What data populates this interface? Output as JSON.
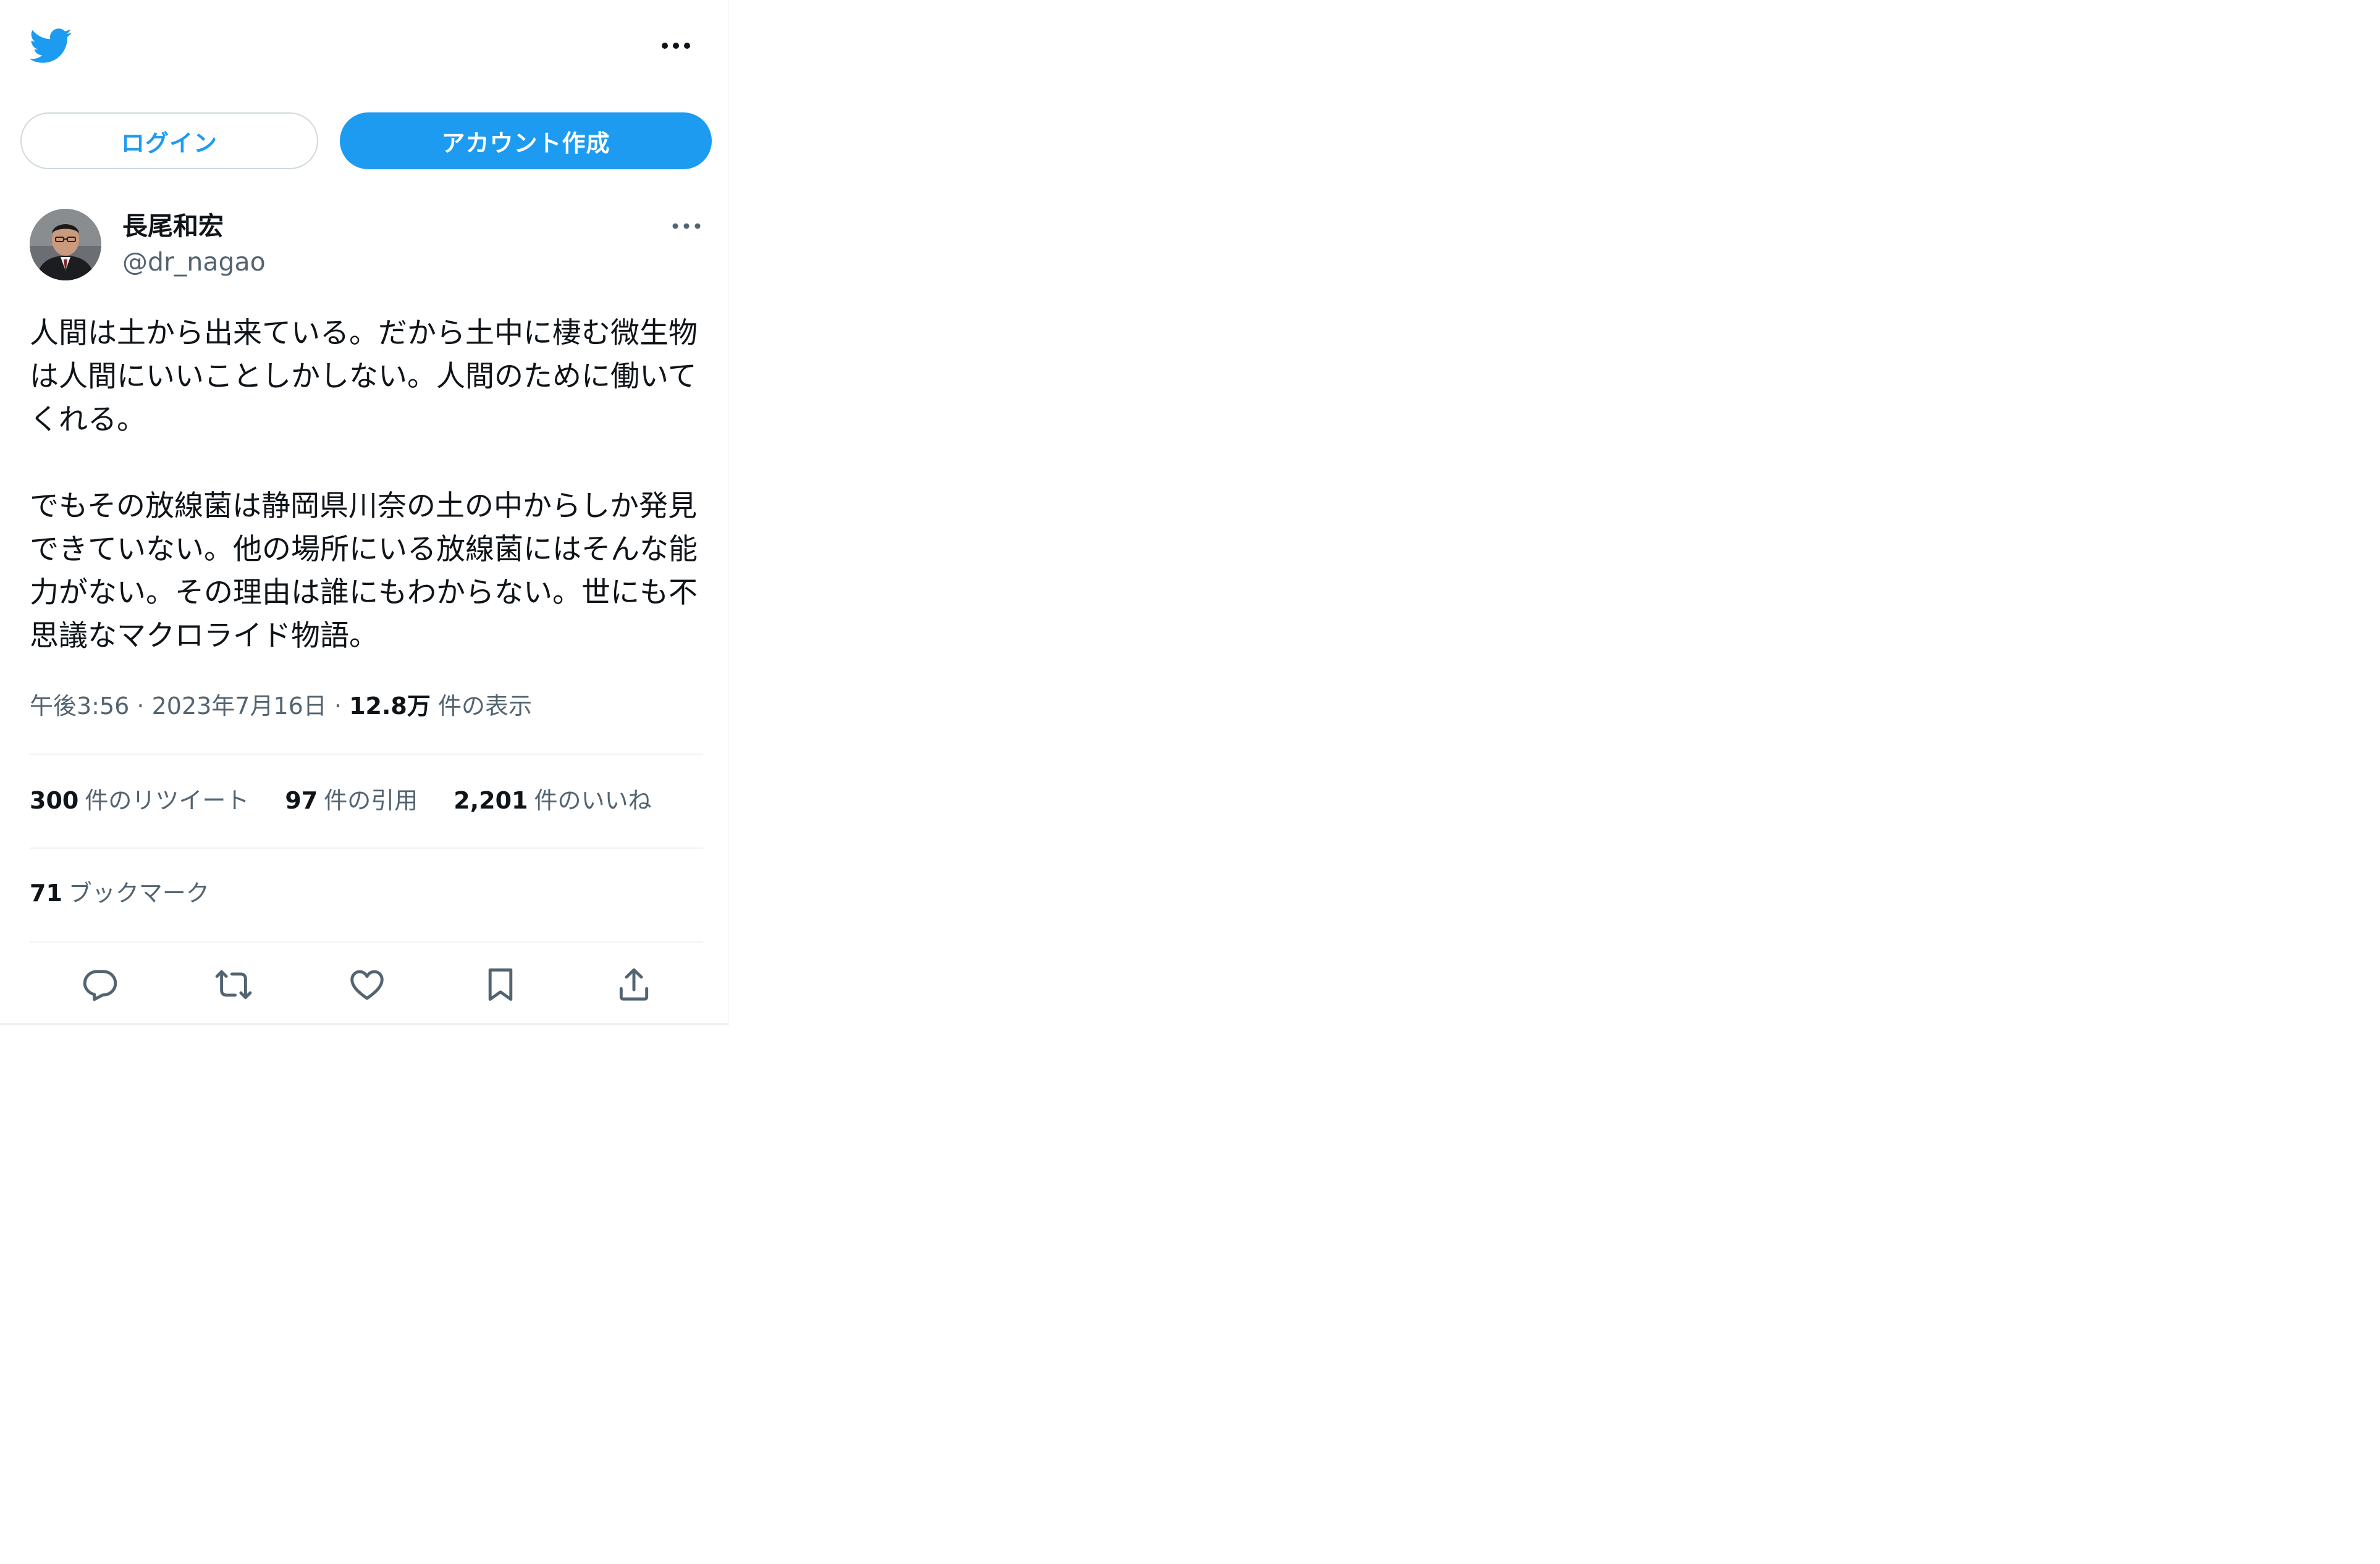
{
  "header": {
    "logo_icon": "twitter-bird-icon",
    "more_icon": "more-horizontal-icon"
  },
  "auth": {
    "login_label": "ログイン",
    "signup_label": "アカウント作成"
  },
  "tweet": {
    "author_name": "長尾和宏",
    "author_handle": "@dr_nagao",
    "body_paragraph_1": "人間は土から出来ている。だから土中に棲む微生物は人間にいいことしかしない。人間のために働いてくれる。",
    "body_paragraph_2": "でもその放線菌は静岡県川奈の土の中からしか発見できていない。他の場所にいる放線菌にはそんな能力がない。その理由は誰にもわからない。世にも不思議なマクロライド物語。",
    "time": "午後3:56",
    "separator_1": " · ",
    "date": "2023年7月16日",
    "separator_2": " · ",
    "views_count": "12.8万",
    "views_label": "件の表示"
  },
  "stats": {
    "retweets_count": "300",
    "retweets_label": "件のリツイート",
    "quotes_count": "97",
    "quotes_label": "件の引用",
    "likes_count": "2,201",
    "likes_label": "件のいいね",
    "bookmarks_count": "71",
    "bookmarks_label": "ブックマーク"
  },
  "actions": [
    {
      "name": "reply-icon"
    },
    {
      "name": "retweet-icon"
    },
    {
      "name": "like-icon"
    },
    {
      "name": "bookmark-icon"
    },
    {
      "name": "share-icon"
    }
  ],
  "colors": {
    "brand_blue": "#1d9bf0",
    "text_primary": "#0f1419",
    "text_secondary": "#536471",
    "divider": "#eff3f4"
  }
}
